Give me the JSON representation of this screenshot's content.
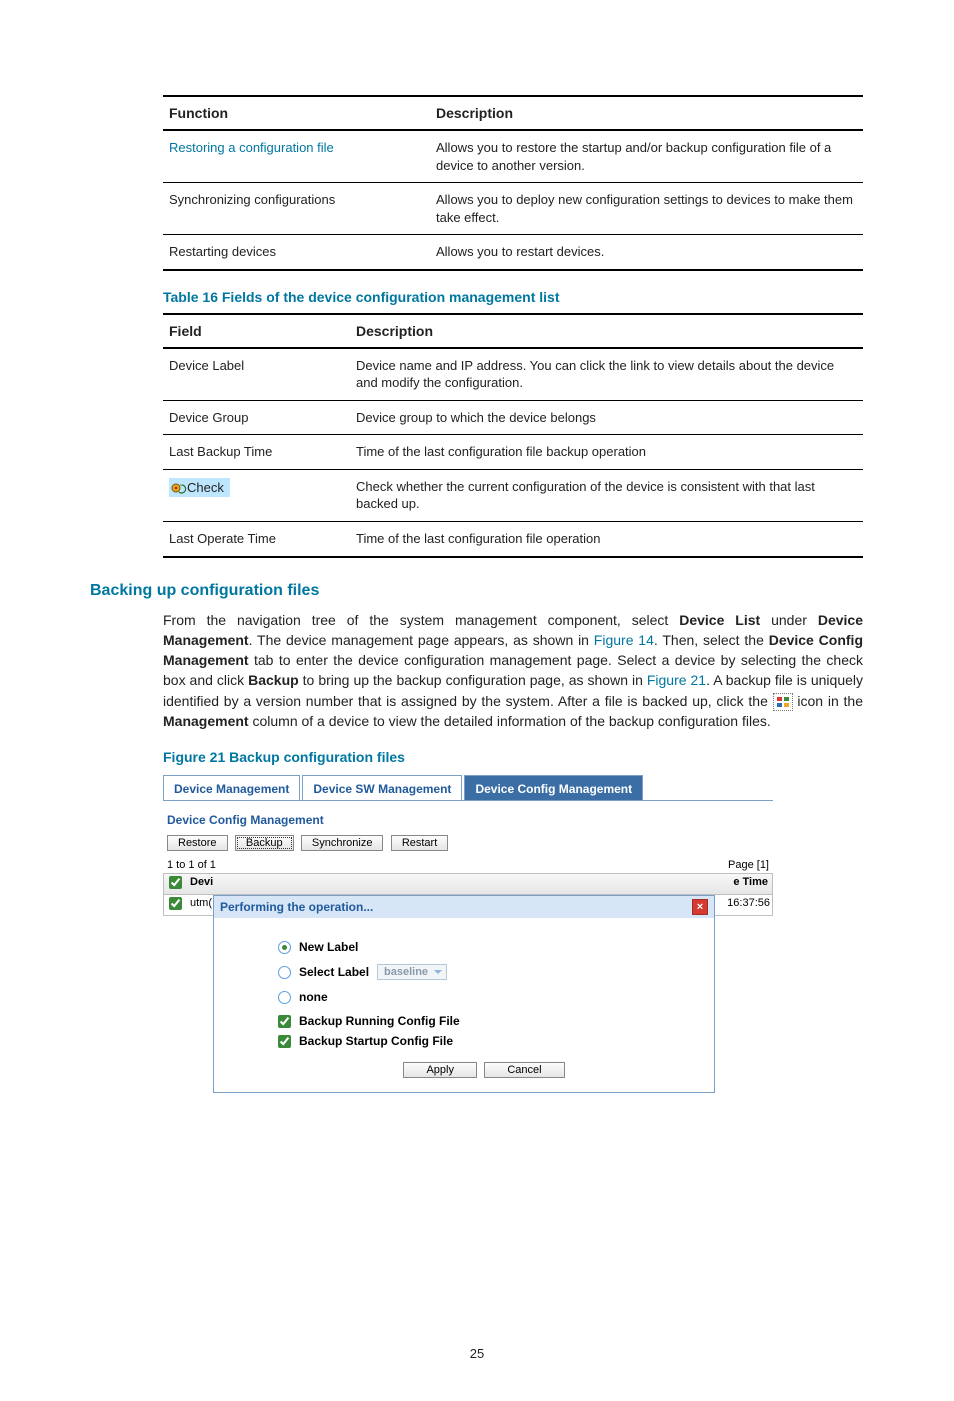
{
  "tables": {
    "t1": {
      "headers": [
        "Function",
        "Description"
      ],
      "rows": [
        {
          "fn": "Restoring a configuration file",
          "link": true,
          "desc": "Allows you to restore the startup and/or backup configuration file of a device to another version."
        },
        {
          "fn": "Synchronizing configurations",
          "link": false,
          "desc": "Allows you to deploy new configuration settings to devices to make them take effect."
        },
        {
          "fn": "Restarting devices",
          "link": false,
          "desc": "Allows you to restart devices."
        }
      ]
    },
    "t2_caption": "Table 16 Fields of the device configuration management list",
    "t2": {
      "headers": [
        "Field",
        "Description"
      ],
      "rows": [
        {
          "f": "Device Label",
          "d": "Device name and IP address. You can click the link to view details about the device and modify the configuration."
        },
        {
          "f": "Device Group",
          "d": "Device group to which the device belongs"
        },
        {
          "f": "Last Backup Time",
          "d": "Time of the last configuration file backup operation"
        },
        {
          "f": "__check__",
          "check_label": "Check",
          "d": "Check whether the current configuration of the device is consistent with that last backed up."
        },
        {
          "f": "Last Operate Time",
          "d": "Time of the last configuration file operation"
        }
      ]
    }
  },
  "section_title": "Backing up configuration files",
  "para": {
    "p1a": "From the navigation tree of the system management component, select ",
    "p1b": "Device List",
    "p1c": " under ",
    "p1d": "Device Management",
    "p1e": ". The device management page appears, as shown in ",
    "p1f": "Figure 14",
    "p1g": ". Then, select the ",
    "p1h": "Device Config Management",
    "p1i": " tab to enter the device configuration management page. Select a device by selecting the check box and click ",
    "p1j": "Backup",
    "p1k": " to bring up the backup configuration page, as shown in ",
    "p1l": "Figure 21",
    "p1m": ". A backup file is uniquely identified by a version number that is assigned by the system. After a file is backed up, click the ",
    "p1n": " icon in the ",
    "p1o": "Management",
    "p1p": " column of a device to view the detailed information of the backup configuration files."
  },
  "fig_caption": "Figure 21 Backup configuration files",
  "fig": {
    "tabs": [
      "Device Management",
      "Device SW Management",
      "Device Config Management"
    ],
    "active_tab": 2,
    "subtitle": "Device Config Management",
    "buttons": [
      "Restore",
      "Backup",
      "Synchronize",
      "Restart"
    ],
    "focused_button": 1,
    "pager_left": "1 to 1 of 1",
    "pager_right": "Page [1]",
    "grid_head_label_prefix": "Devi",
    "grid_head_time": "e Time",
    "grid_row_label": "utm(",
    "grid_row_time": "16:37:56",
    "dialog": {
      "title": "Performing the operation...",
      "options": {
        "new_label": "New Label",
        "select_label": "Select Label",
        "select_value": "baseline",
        "none": "none"
      },
      "chk1": "Backup Running Config File",
      "chk2": "Backup Startup Config File",
      "apply": "Apply",
      "cancel": "Cancel"
    }
  },
  "page_number": "25"
}
